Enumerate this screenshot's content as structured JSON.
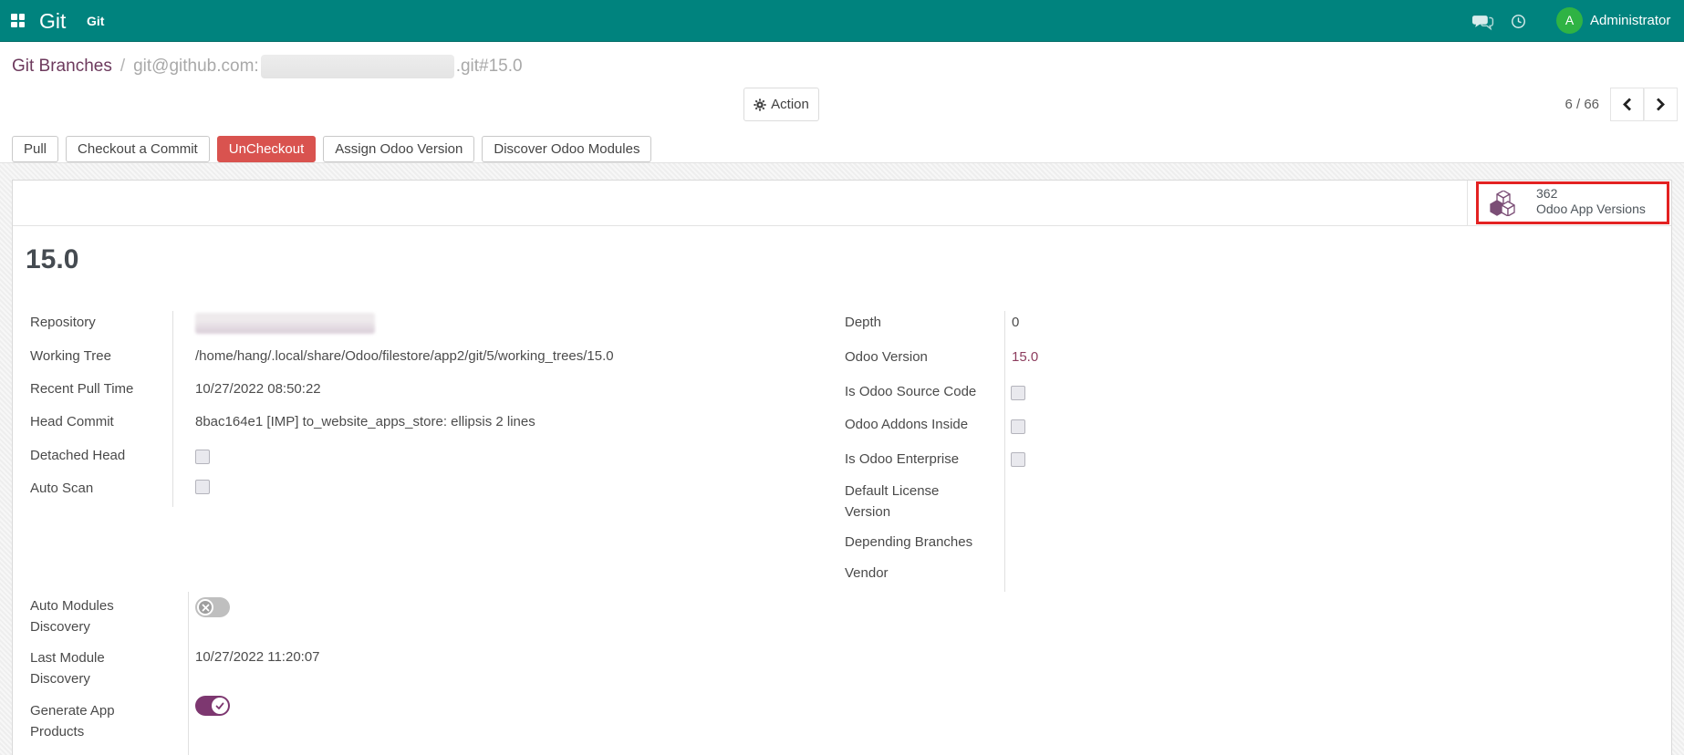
{
  "colors": {
    "navbar_bg": "#00837e",
    "avatar_green": "#2fb344",
    "danger": "#d9534f",
    "toggle_on": "#7d3770",
    "breadcrumb_link": "#6d3a5d",
    "highlight_red": "#e32222",
    "stat_icon_purple": "#7b4e76",
    "version_link": "#8d3d5e"
  },
  "navbar": {
    "brand": "Git",
    "menu_item": "Git",
    "user": "Administrator",
    "avatar_initial": "A"
  },
  "breadcrumb": {
    "parent": "Git Branches",
    "separator": "/",
    "current_prefix": "git@github.com:",
    "current_redacted": true,
    "current_suffix": ".git#15.0"
  },
  "control_panel": {
    "action_label": "Action",
    "pager_count": "6 / 66"
  },
  "status_buttons": [
    {
      "label": "Pull",
      "variant": "secondary"
    },
    {
      "label": "Checkout a Commit",
      "variant": "secondary"
    },
    {
      "label": "UnCheckout",
      "variant": "danger"
    },
    {
      "label": "Assign Odoo Version",
      "variant": "secondary"
    },
    {
      "label": "Discover Odoo Modules",
      "variant": "secondary"
    }
  ],
  "stat_button": {
    "value": "362",
    "label": "Odoo App Versions",
    "highlighted": true
  },
  "sheet": {
    "title": "15.0"
  },
  "fields": {
    "repository": {
      "label": "Repository",
      "redacted": true
    },
    "working_tree": {
      "label": "Working Tree",
      "value": "/home/hang/.local/share/Odoo/filestore/app2/git/5/working_trees/15.0"
    },
    "recent_pull_time": {
      "label": "Recent Pull Time",
      "value": "10/27/2022 08:50:22"
    },
    "head_commit": {
      "label": "Head Commit",
      "value": "8bac164e1 [IMP] to_website_apps_store: ellipsis 2 lines"
    },
    "detached_head": {
      "label": "Detached Head",
      "checked": false
    },
    "auto_scan": {
      "label": "Auto Scan",
      "checked": false
    },
    "depth": {
      "label": "Depth",
      "value": "0"
    },
    "odoo_version": {
      "label": "Odoo Version",
      "value": "15.0"
    },
    "is_odoo_source_code": {
      "label": "Is Odoo Source Code",
      "checked": false
    },
    "odoo_addons_inside": {
      "label": "Odoo Addons Inside",
      "checked": false
    },
    "is_odoo_enterprise": {
      "label": "Is Odoo Enterprise",
      "checked": false
    },
    "default_license_version": {
      "label": "Default License Version",
      "value": ""
    },
    "depending_branches": {
      "label": "Depending Branches",
      "value": ""
    },
    "vendor": {
      "label": "Vendor",
      "value": ""
    },
    "auto_modules_discovery": {
      "label": "Auto Modules Discovery",
      "toggle": false
    },
    "last_module_discovery": {
      "label": "Last Module Discovery",
      "value": "10/27/2022 11:20:07"
    },
    "generate_app_products": {
      "label": "Generate App Products",
      "toggle": true
    }
  }
}
